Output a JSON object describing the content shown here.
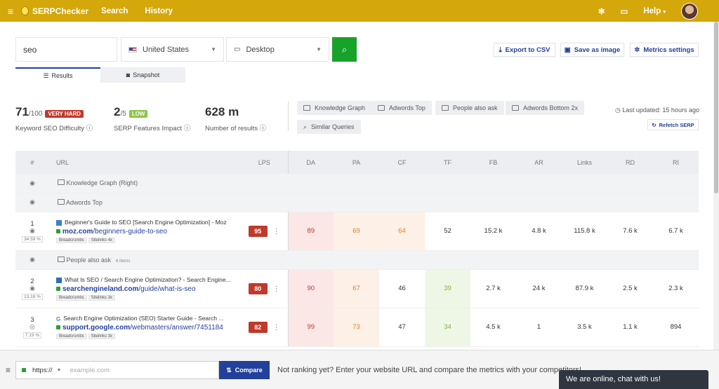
{
  "topbar": {
    "app_name": "SERPChecker",
    "nav": [
      "Search",
      "History"
    ],
    "help_label": "Help",
    "bg_color": "#d4a70a"
  },
  "search": {
    "keyword_value": "seo",
    "country": "United States",
    "device": "Desktop",
    "export_label": "Export to CSV",
    "save_image_label": "Save as image",
    "metrics_settings_label": "Metrics settings",
    "tabs": [
      "Results",
      "Snapshot"
    ]
  },
  "metrics": {
    "difficulty": {
      "value": "71",
      "of": "/100",
      "badge": "VERY HARD",
      "badge_color": "#c0392b",
      "label": "Keyword SEO Difficulty"
    },
    "serp_impact": {
      "value": "2",
      "of": "/5",
      "badge": "LOW",
      "badge_color": "#8bc34a",
      "label": "SERP Features Impact"
    },
    "results": {
      "value": "628 m",
      "label": "Number of results"
    }
  },
  "features": [
    "Knowledge Graph",
    "Adwords Top",
    "People also ask",
    "Adwords Bottom 2x",
    "Similar Queries"
  ],
  "last_updated": "Last updated: 15 hours ago",
  "refetch_label": "Refetch SERP",
  "table": {
    "headers": [
      "#",
      "URL",
      "LPS",
      "DA",
      "PA",
      "CF",
      "TF",
      "FB",
      "AR",
      "Links",
      "RD",
      "RI"
    ],
    "group_knowledge": "Knowledge Graph (Right)",
    "group_adwords": "Adwords Top",
    "group_paa": "People also ask",
    "group_paa_count": "4 items",
    "rows": [
      {
        "pos": "1",
        "pct": "34.59 %",
        "title": "Beginner's Guide to SEO [Search Engine Optimization] - Moz",
        "domain": "moz.com",
        "path": "/beginners-guide-to-seo",
        "tags": [
          "Breadcrumbs",
          "Sitelinks 4x"
        ],
        "lps": "95",
        "da": "89",
        "pa": "69",
        "cf": "64",
        "tf": "52",
        "fb": "15.2 k",
        "ar": "4.8 k",
        "links": "115.8 k",
        "rd": "7.6 k",
        "ri": "6.7 k"
      },
      {
        "pos": "2",
        "pct": "13.18 %",
        "title": "What Is SEO / Search Engine Optimization? - Search Engine...",
        "domain": "searchengineland.com",
        "path": "/guide/what-is-seo",
        "tags": [
          "Breadcrumbs",
          "Sitelinks 3x"
        ],
        "lps": "80",
        "da": "90",
        "pa": "67",
        "cf": "46",
        "tf": "39",
        "fb": "2.7 k",
        "ar": "24 k",
        "links": "87.9 k",
        "rd": "2.5 k",
        "ri": "2.3 k"
      },
      {
        "pos": "3",
        "pct": "7.19 %",
        "title": "Search Engine Optimization (SEO) Starter Guide - Search ...",
        "domain": "support.google.com",
        "path": "/webmasters/answer/7451184",
        "tags": [
          "Breadcrumbs",
          "Sitelinks 3x"
        ],
        "lps": "82",
        "da": "99",
        "pa": "73",
        "cf": "47",
        "tf": "34",
        "fb": "4.5 k",
        "ar": "1",
        "links": "3.5 k",
        "rd": "1.1 k",
        "ri": "894"
      }
    ]
  },
  "compare": {
    "protocol": "https://",
    "placeholder": "example.com",
    "button": "Compare",
    "message": "Not ranking yet? Enter your website URL and compare the metrics with your competitors!"
  },
  "chat_label": "We are online, chat with us!"
}
